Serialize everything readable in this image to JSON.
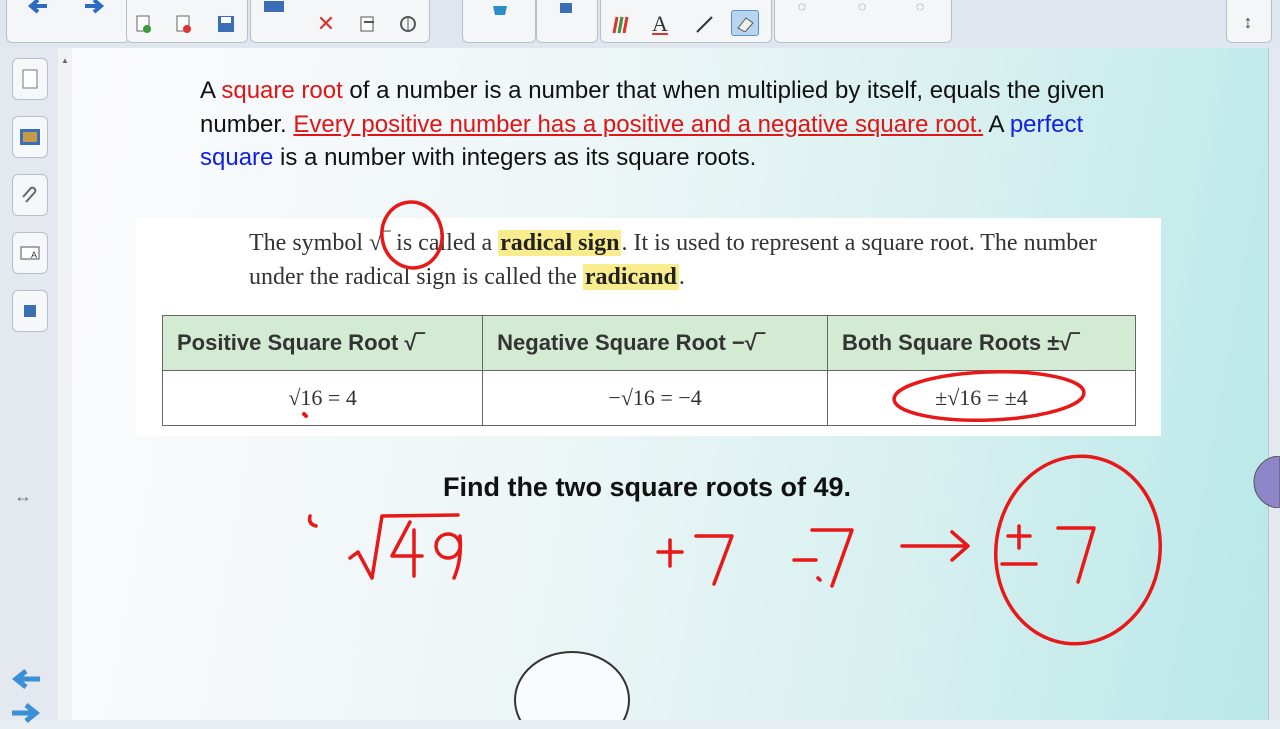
{
  "toolbar": {
    "icons": [
      "back-arrow-icon",
      "forward-arrow-icon",
      "new-page-icon",
      "delete-page-icon",
      "save-icon",
      "screen-display-icon",
      "close-icon",
      "paste-icon",
      "tools-icon",
      "gallery-icon",
      "puzzle-icon",
      "pens-icon",
      "text-icon",
      "line-icon",
      "eraser-icon",
      "magic-pen-icon",
      "selection-icon",
      "view-toggle-icon"
    ]
  },
  "sidebar": {
    "tabs": [
      "page-sorter-icon",
      "gallery-icon",
      "attachments-icon",
      "properties-icon",
      "addons-icon"
    ]
  },
  "lesson": {
    "p1": "A ",
    "p2": "square root",
    "p3": " of a number is a number that when multiplied by itself, equals the given number. ",
    "p4": "Every positive number has a positive and a negative square root.",
    "p5": " A ",
    "p6": "perfect square",
    "p7": " is a number with integers as its square roots."
  },
  "textbook": {
    "t1": "The symbol ",
    "sym": "√‾",
    "t2": " is called a ",
    "radical_sign": "radical sign",
    "t3": ". It is used to represent a square root. The number under the radical sign is called the ",
    "radicand": "radicand",
    "t4": "."
  },
  "table": {
    "headers": [
      "Positive Square Root √‾",
      "Negative Square Root −√‾",
      "Both Square Roots ±√‾"
    ],
    "values": [
      "√16 = 4",
      "−√16 = −4",
      "±√16 = ±4"
    ]
  },
  "prompt": "Find the two square roots of 49.",
  "colors": {
    "accent_red": "#e01515",
    "accent_blue": "#1020e0",
    "highlight": "#f8ec8c",
    "table_header": "#d3ead3"
  }
}
